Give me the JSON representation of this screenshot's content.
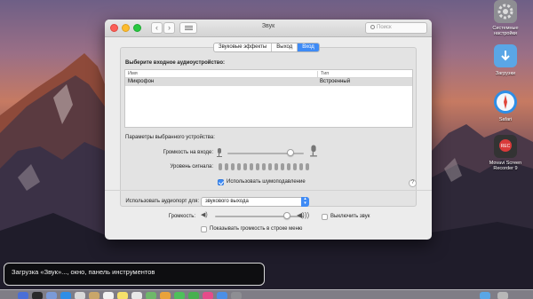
{
  "window": {
    "title": "Звук",
    "search_placeholder": "Поиск",
    "nav_back": "‹",
    "nav_forward": "›"
  },
  "tabs": [
    {
      "label": "Звуковые эффекты",
      "active": false
    },
    {
      "label": "Выход",
      "active": false
    },
    {
      "label": "Вход",
      "active": true
    }
  ],
  "input": {
    "heading": "Выберите входное аудиоустройство:",
    "columns": {
      "name": "Имя",
      "type": "Тип"
    },
    "devices": [
      {
        "name": "Микрофон",
        "type": "Встроенный",
        "selected": true
      }
    ],
    "settings_heading": "Параметры выбранного устройства:",
    "input_volume_label": "Громкость на входе:",
    "input_volume_fraction": 0.83,
    "signal_level_label": "Уровень сигнала:",
    "noise_reduction_label": "Использовать шумоподавление",
    "noise_reduction_checked": true
  },
  "footer": {
    "use_port_label": "Использовать аудиопорт для:",
    "port_value": "звукового выхода",
    "volume_label": "Громкость:",
    "volume_fraction": 0.81,
    "mute_label": "Выключить звук",
    "mute_checked": false,
    "show_in_menubar_label": "Показывать громкость в строке меню",
    "show_in_menubar_checked": false
  },
  "desktop_icons": [
    {
      "label": "Системные настройки",
      "icon": "gear-icon",
      "color": "#8e8e93"
    },
    {
      "label": "Загрузки",
      "icon": "downloads-folder-icon",
      "color": "#5aa6e6"
    },
    {
      "label": "Safari",
      "icon": "compass-icon",
      "color": "#2e8ee6"
    },
    {
      "label": "Movavi Screen Recorder 9",
      "icon": "rec-icon",
      "color": "#d93a3a"
    }
  ],
  "caption": "Загрузка «Звук»..., окно, панель инструментов",
  "colors": {
    "accent": "#3f8bf5"
  }
}
